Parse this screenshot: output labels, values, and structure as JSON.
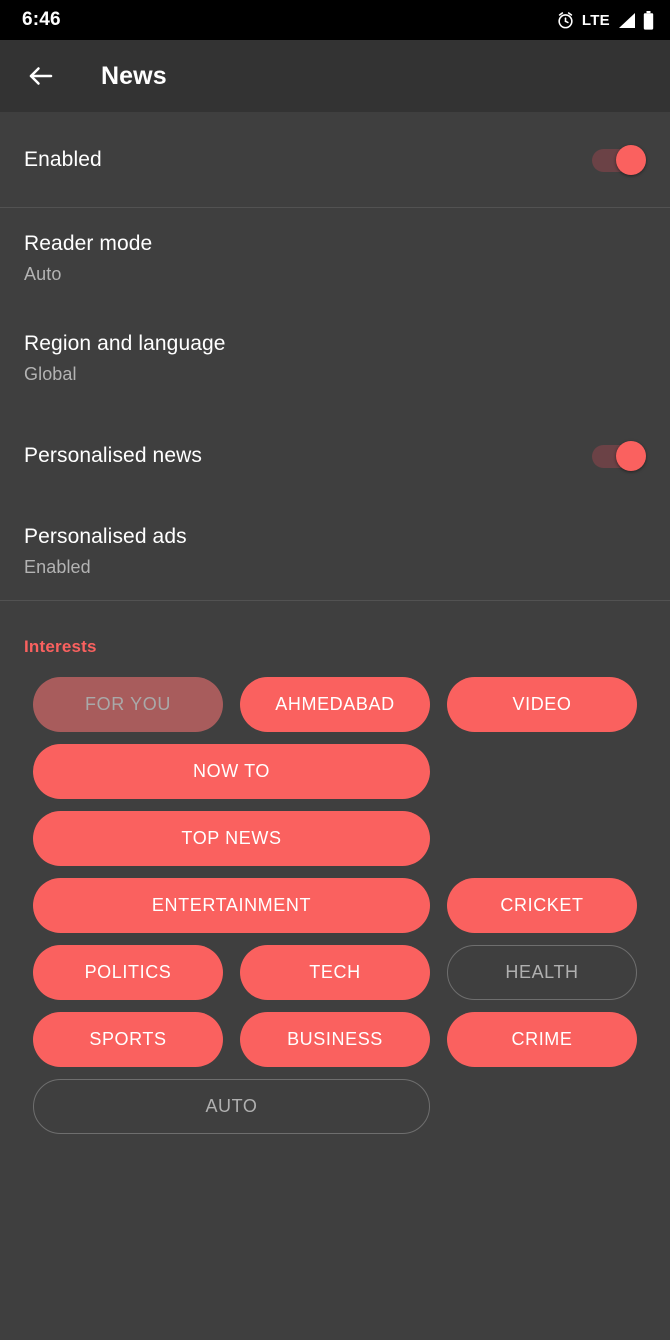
{
  "status_bar": {
    "time": "6:46",
    "network_label": "LTE",
    "icons": [
      "alarm-clock-icon",
      "lte-label",
      "signal-icon",
      "battery-icon"
    ]
  },
  "app_bar": {
    "back_icon": "back-arrow-icon",
    "title": "News"
  },
  "settings": [
    {
      "title": "Enabled",
      "subtitle": "",
      "control": "switch",
      "switch_on": true
    },
    {
      "title": "Reader mode",
      "subtitle": "Auto",
      "control": "none",
      "switch_on": false
    },
    {
      "title": "Region and language",
      "subtitle": "Global",
      "control": "none",
      "switch_on": false
    },
    {
      "title": "Personalised news",
      "subtitle": "",
      "control": "switch",
      "switch_on": true
    },
    {
      "title": "Personalised ads",
      "subtitle": "Enabled",
      "control": "none",
      "switch_on": false
    }
  ],
  "interests": {
    "header": "Interests",
    "chips": [
      {
        "label": "FOR YOU",
        "state": "active",
        "span": 1
      },
      {
        "label": "AHMEDABAD",
        "state": "selected",
        "span": 1
      },
      {
        "label": "VIDEO",
        "state": "selected",
        "span": 1
      },
      {
        "label": "NOW TO",
        "state": "selected",
        "span": 2
      },
      {
        "label": "TOP NEWS",
        "state": "selected",
        "span": 2
      },
      {
        "label": "ENTERTAINMENT",
        "state": "selected",
        "span": 2
      },
      {
        "label": "CRICKET",
        "state": "selected",
        "span": 1
      },
      {
        "label": "POLITICS",
        "state": "selected",
        "span": 1
      },
      {
        "label": "TECH",
        "state": "selected",
        "span": 1
      },
      {
        "label": "HEALTH",
        "state": "unselected",
        "span": 1
      },
      {
        "label": "SPORTS",
        "state": "selected",
        "span": 1
      },
      {
        "label": "BUSINESS",
        "state": "selected",
        "span": 1
      },
      {
        "label": "CRIME",
        "state": "selected",
        "span": 1
      },
      {
        "label": "AUTO",
        "state": "unselected",
        "span": 2
      }
    ]
  },
  "colors": {
    "accent": "#fa615f",
    "accent_muted": "#a85c5c",
    "background": "#3f3f3f",
    "app_bar": "#333333",
    "status_bar": "#000000",
    "divider": "#525252",
    "text_primary": "#ffffff",
    "text_secondary": "#b3b3b3",
    "chip_border": "#6e6e6e"
  }
}
